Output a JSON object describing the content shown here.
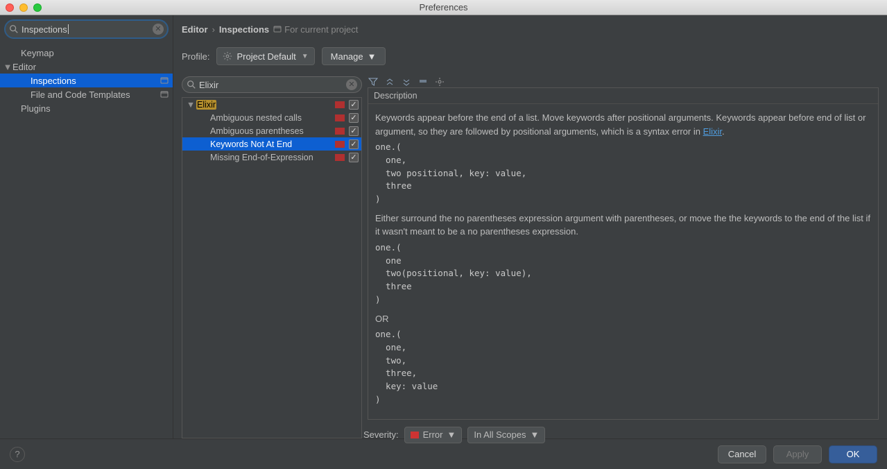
{
  "window": {
    "title": "Preferences"
  },
  "sidebar": {
    "search_value": "Inspections",
    "items": [
      {
        "label": "Keymap",
        "level": 1,
        "expandable": false,
        "badge": false
      },
      {
        "label": "Editor",
        "level": 1,
        "expandable": true,
        "expanded": true,
        "badge": false
      },
      {
        "label": "Inspections",
        "level": 2,
        "selected": true,
        "badge": true
      },
      {
        "label": "File and Code Templates",
        "level": 2,
        "badge": true
      },
      {
        "label": "Plugins",
        "level": 1,
        "expandable": false
      }
    ]
  },
  "breadcrumb": {
    "part1": "Editor",
    "part2": "Inspections",
    "scope": "For current project"
  },
  "profile": {
    "label": "Profile:",
    "value": "Project Default",
    "manage_label": "Manage"
  },
  "inspections": {
    "search_value": "Elixir",
    "group": "Elixir",
    "items": [
      {
        "label": "Ambiguous nested calls"
      },
      {
        "label": "Ambiguous parentheses"
      },
      {
        "label": "Keywords Not At End",
        "selected": true
      },
      {
        "label": "Missing End-of-Expression"
      }
    ]
  },
  "description": {
    "heading": "Description",
    "para1_a": "Keywords appear before the end of a list. Move keywords after positional arguments. Keywords appear before end of list or argument, so they are followed by positional arguments, which is a syntax error in ",
    "link1": "Elixir",
    "para1_b": ".",
    "code1": "one.(\n  one,\n  two positional, key: value,\n  three\n)",
    "para2": "Either surround the no parentheses expression argument with parentheses, or move the the keywords to the end of the list if it wasn't meant to be a no parentheses expression.",
    "code2": "one.(\n  one\n  two(positional, key: value),\n  three\n)",
    "or_label": "OR",
    "code3": "one.(\n  one,\n  two,\n  three,\n  key: value\n)"
  },
  "severity": {
    "label": "Severity:",
    "level": "Error",
    "scope": "In All Scopes"
  },
  "footer": {
    "cancel": "Cancel",
    "apply": "Apply",
    "ok": "OK"
  }
}
